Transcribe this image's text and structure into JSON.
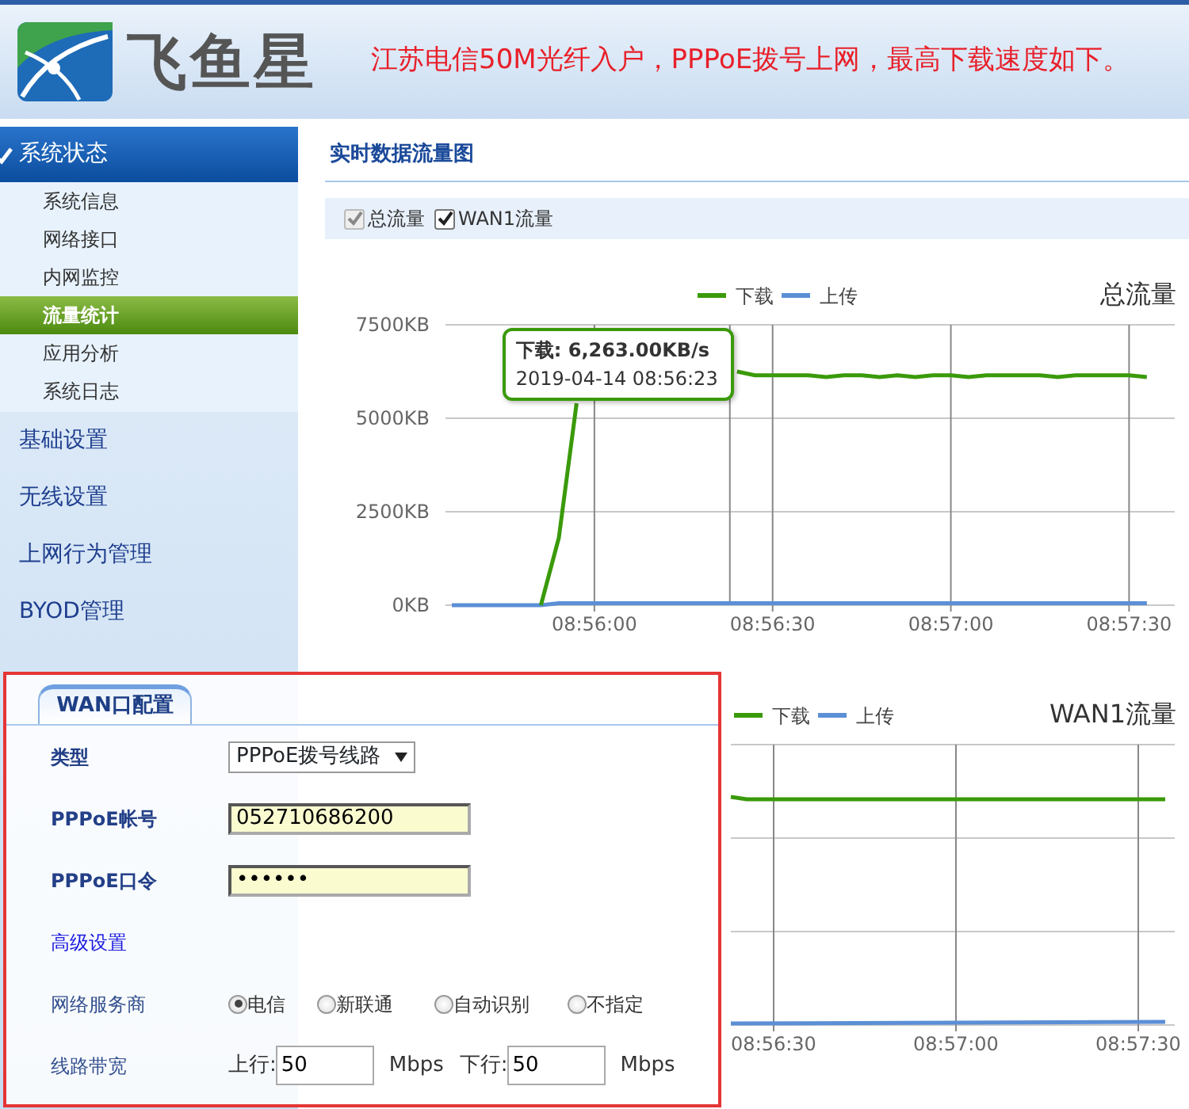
{
  "header": {
    "logo_text": "飞鱼星",
    "headline": "江苏电信50M光纤入户，PPPoE拨号上网，最高下载速度如下。"
  },
  "sidebar": {
    "items": [
      {
        "label": "系统状态",
        "expanded": true,
        "children": [
          {
            "label": "系统信息",
            "selected": false
          },
          {
            "label": "网络接口",
            "selected": false
          },
          {
            "label": "内网监控",
            "selected": false
          },
          {
            "label": "流量统计",
            "selected": true
          },
          {
            "label": "应用分析",
            "selected": false
          },
          {
            "label": "系统日志",
            "selected": false
          }
        ]
      },
      {
        "label": "基础设置",
        "expanded": false
      },
      {
        "label": "无线设置",
        "expanded": false
      },
      {
        "label": "上网行为管理",
        "expanded": false
      },
      {
        "label": "BYOD管理",
        "expanded": false
      }
    ]
  },
  "main": {
    "title": "实时数据流量图",
    "toggles": [
      {
        "label": "总流量",
        "checked": true,
        "disabled": true
      },
      {
        "label": "WAN1流量",
        "checked": true,
        "disabled": false
      }
    ],
    "total_chart": {
      "chart_data": {
        "type": "line",
        "title": "总流量",
        "categories": [
          null,
          null,
          null,
          null,
          null,
          null,
          null,
          null,
          "08:56:00",
          null,
          null,
          null,
          null,
          null,
          null,
          null,
          null,
          null,
          "08:56:30",
          null,
          null,
          null,
          null,
          null,
          null,
          null,
          null,
          null,
          "08:57:00",
          null,
          null,
          null,
          null,
          null,
          null,
          null,
          null,
          null,
          "08:57:30",
          null
        ],
        "grid": true,
        "legend": "top",
        "series": [
          {
            "name": "下载",
            "color": "#3a9a0a",
            "values": [
              null,
              null,
              null,
              null,
              null,
              0,
              1800,
              5400,
              null,
              null,
              null,
              null,
              null,
              null,
              null,
              null,
              6250,
              6150,
              6150,
              6150,
              6150,
              6100,
              6150,
              6150,
              6100,
              6150,
              6100,
              6150,
              6150,
              6100,
              6150,
              6150,
              6150,
              6150,
              6100,
              6150,
              6150,
              6150,
              6150,
              6100
            ]
          },
          {
            "name": "上传",
            "color": "#5b8fd6",
            "values": [
              0,
              0,
              0,
              0,
              0,
              0,
              50,
              50,
              50,
              50,
              50,
              50,
              50,
              50,
              50,
              50,
              50,
              50,
              50,
              50,
              50,
              50,
              50,
              50,
              50,
              50,
              50,
              50,
              50,
              50,
              50,
              50,
              50,
              50,
              50,
              50,
              50,
              50,
              50,
              50
            ]
          }
        ],
        "ylim": [
          0,
          7500
        ],
        "yticks": [
          {
            "value": 0,
            "label": "0KB"
          },
          {
            "value": 2500,
            "label": "2500KB"
          },
          {
            "value": 5000,
            "label": "5000KB"
          },
          {
            "value": 7500,
            "label": "7500KB"
          }
        ]
      },
      "tooltip": {
        "headline": "下载: 6,263.00KB/s",
        "time": "2019-04-14 08:56:23"
      }
    },
    "wan1_chart": {
      "title": "WAN1流量",
      "legend": [
        {
          "name": "下载",
          "color": "#3a9a0a"
        },
        {
          "name": "上传",
          "color": "#5b8fd6"
        }
      ],
      "x_labels": [
        "08:56:30",
        "08:57:00",
        "08:57:30"
      ]
    }
  },
  "wan_panel": {
    "tab": {
      "label": "WAN口配置",
      "selected": true
    },
    "fields": [
      {
        "kind": "select",
        "label": "类型",
        "bold": true,
        "value": "PPPoE拨号线路"
      },
      {
        "kind": "text",
        "label": "PPPoE帐号",
        "bold": true,
        "value": "052710686200"
      },
      {
        "kind": "password",
        "label": "PPPoE口令",
        "bold": true,
        "value": "••••••"
      },
      {
        "kind": "link",
        "label": "高级设置"
      },
      {
        "kind": "radio",
        "label": "网络服务商",
        "bold": false,
        "options": [
          {
            "label": "电信",
            "selected": true
          },
          {
            "label": "新联通",
            "selected": false
          },
          {
            "label": "自动识别",
            "selected": false
          },
          {
            "label": "不指定",
            "selected": false
          }
        ]
      },
      {
        "kind": "bandwidth",
        "label": "线路带宽",
        "bold": false,
        "up_label": "上行:",
        "up_value": "50",
        "up_unit": "Mbps",
        "down_label": "下行:",
        "down_value": "50",
        "down_unit": "Mbps"
      }
    ]
  }
}
